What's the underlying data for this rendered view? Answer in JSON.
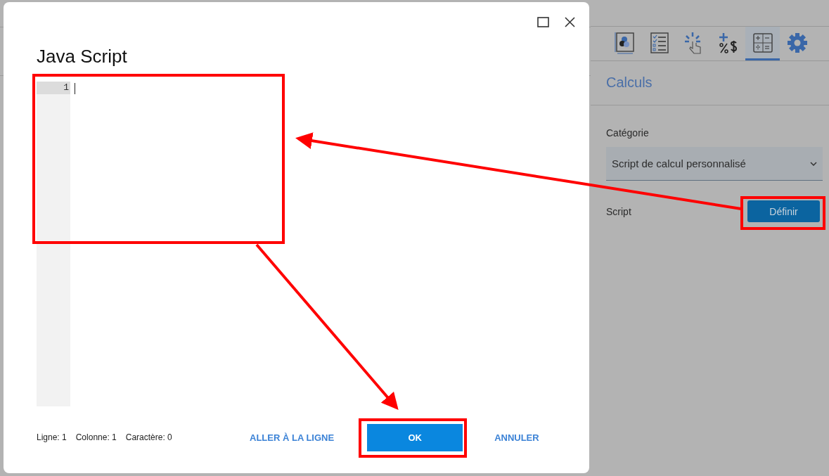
{
  "panel": {
    "tabs": [
      {
        "selected": false
      },
      {
        "selected": false
      },
      {
        "selected": false
      },
      {
        "selected": false
      },
      {
        "selected": true
      },
      {
        "selected": false
      }
    ],
    "heading": "Calculs",
    "category": {
      "label": "Catégorie",
      "value": "Script de calcul personnalisé"
    },
    "script": {
      "label": "Script",
      "button": "Définir"
    }
  },
  "dialog": {
    "title": "Java Script",
    "editor": {
      "line_numbers": [
        "1"
      ]
    },
    "status": [
      {
        "label": "Ligne:",
        "value": "1"
      },
      {
        "label": "Colonne:",
        "value": "1"
      },
      {
        "label": "Caractère:",
        "value": "0"
      }
    ],
    "buttons": [
      {
        "label": "ALLER À LA LIGNE",
        "kind": "text"
      },
      {
        "label": "OK",
        "kind": "primary"
      },
      {
        "label": "ANNULER",
        "kind": "text"
      }
    ]
  }
}
